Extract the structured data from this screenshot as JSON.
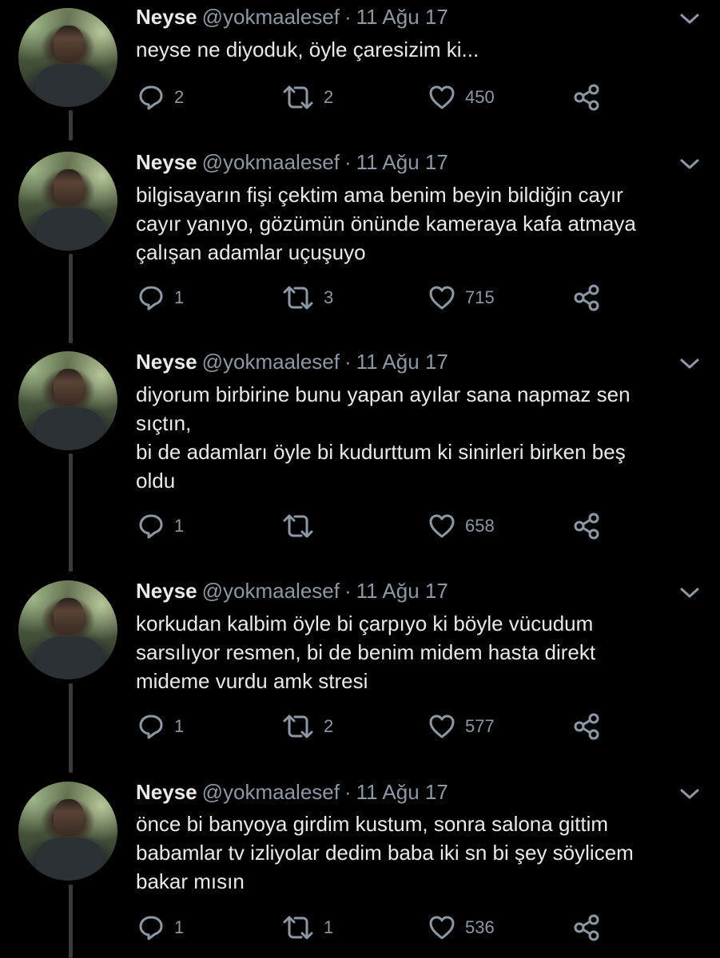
{
  "tweets": [
    {
      "name": "Neyse",
      "handle": "@yokmaalesef",
      "separator": "·",
      "date": "11 Ağu 17",
      "lines": [
        "neyse ne diyoduk, öyle çaresizim ki..."
      ],
      "reply_count": "2",
      "retweet_count": "2",
      "like_count": "450"
    },
    {
      "name": "Neyse",
      "handle": "@yokmaalesef",
      "separator": "·",
      "date": "11 Ağu 17",
      "lines": [
        "bilgisayarın fişi çektim ama benim beyin bildiğin cayır",
        "cayır yanıyo, gözümün önünde kameraya kafa atmaya",
        "çalışan adamlar uçuşuyo"
      ],
      "reply_count": "1",
      "retweet_count": "3",
      "like_count": "715"
    },
    {
      "name": "Neyse",
      "handle": "@yokmaalesef",
      "separator": "·",
      "date": "11 Ağu 17",
      "lines": [
        "diyorum birbirine bunu yapan ayılar sana napmaz sen",
        "sıçtın,",
        "bi de adamları öyle bi kudurttum ki sinirleri birken beş",
        "oldu"
      ],
      "reply_count": "1",
      "retweet_count": "",
      "like_count": "658"
    },
    {
      "name": "Neyse",
      "handle": "@yokmaalesef",
      "separator": "·",
      "date": "11 Ağu 17",
      "lines": [
        "korkudan kalbim öyle bi çarpıyo ki böyle vücudum",
        "sarsılıyor resmen, bi de benim midem hasta direkt",
        "mideme vurdu amk stresi"
      ],
      "reply_count": "1",
      "retweet_count": "2",
      "like_count": "577"
    },
    {
      "name": "Neyse",
      "handle": "@yokmaalesef",
      "separator": "·",
      "date": "11 Ağu 17",
      "lines": [
        "önce bi banyoya girdim kustum, sonra salona gittim",
        "babamlar tv izliyolar dedim baba iki sn bi şey söylicem",
        "bakar mısın"
      ],
      "reply_count": "1",
      "retweet_count": "1",
      "like_count": "536"
    }
  ],
  "icons": {
    "reply": "reply-icon",
    "retweet": "retweet-icon",
    "like": "heart-icon",
    "share": "share-icon",
    "menu": "chevron-down-icon",
    "avatar": "profile-photo"
  },
  "colors": {
    "background": "#000000",
    "text": "#e7e9ea",
    "secondary": "#8b98a5",
    "thread_line": "#3a3a3a"
  }
}
